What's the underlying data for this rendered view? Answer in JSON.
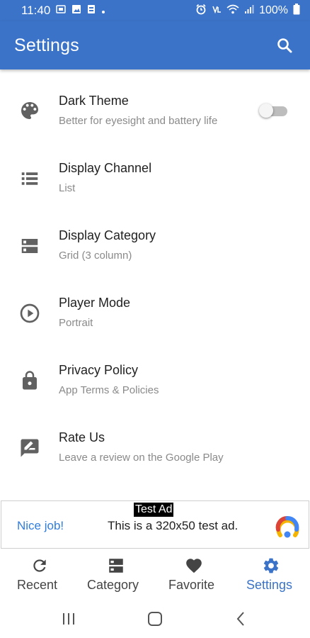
{
  "status_bar": {
    "time": "11:40",
    "battery": "100%"
  },
  "app_bar": {
    "title": "Settings"
  },
  "settings": [
    {
      "title": "Dark Theme",
      "subtitle": "Better for eyesight and battery life",
      "icon": "palette-icon",
      "toggle": false
    },
    {
      "title": "Display Channel",
      "subtitle": "List",
      "icon": "list-icon"
    },
    {
      "title": "Display Category",
      "subtitle": "Grid (3 column)",
      "icon": "grid-icon"
    },
    {
      "title": "Player Mode",
      "subtitle": "Portrait",
      "icon": "play-circle-icon"
    },
    {
      "title": "Privacy Policy",
      "subtitle": "App Terms & Policies",
      "icon": "lock-icon"
    },
    {
      "title": "Rate Us",
      "subtitle": "Leave a review on the Google Play",
      "icon": "rate-review-icon"
    }
  ],
  "ad": {
    "label": "Test Ad",
    "headline": "Nice job!",
    "text": "This is a 320x50 test ad."
  },
  "bottom_nav": [
    {
      "label": "Recent",
      "icon": "refresh-icon",
      "active": false
    },
    {
      "label": "Category",
      "icon": "category-icon",
      "active": false
    },
    {
      "label": "Favorite",
      "icon": "heart-icon",
      "active": false
    },
    {
      "label": "Settings",
      "icon": "gear-icon",
      "active": true
    }
  ],
  "colors": {
    "primary": "#3b73c8",
    "icon_gray": "#616161",
    "subtitle_gray": "#8a8a8a",
    "ad_link_blue": "#2f7de0"
  }
}
